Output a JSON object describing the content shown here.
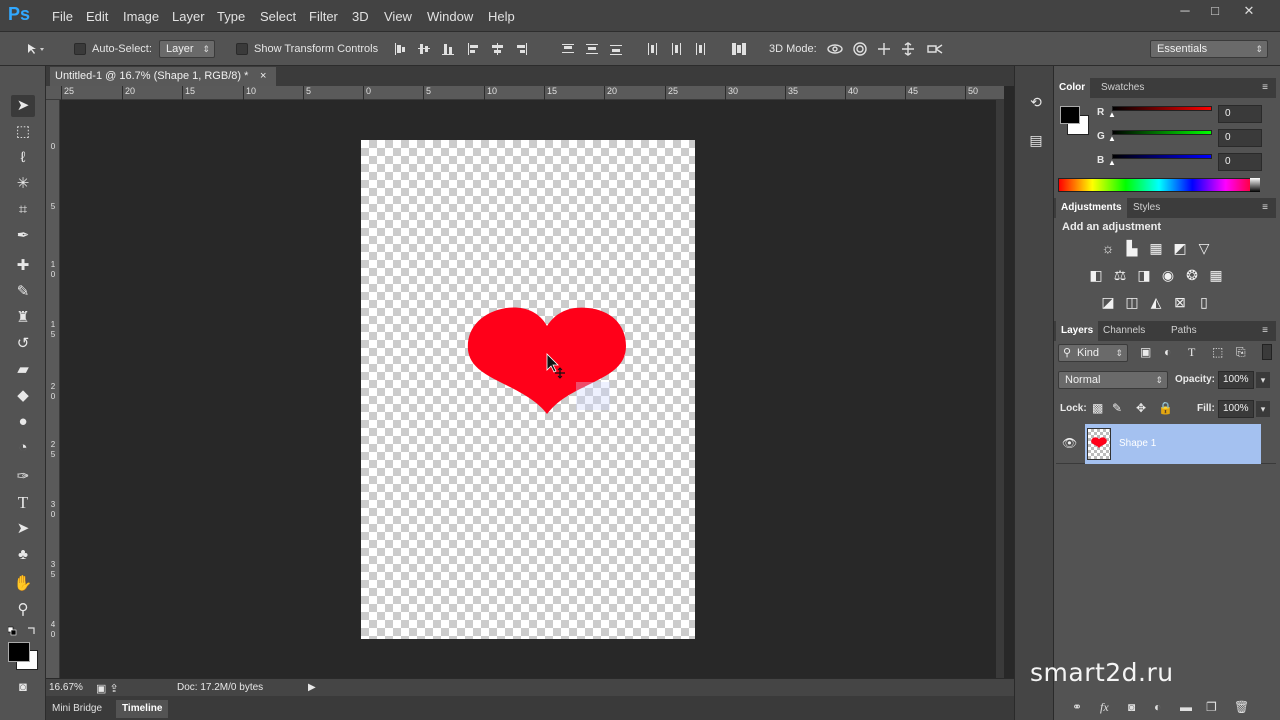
{
  "app": {
    "logo": "Ps"
  },
  "menu": [
    "File",
    "Edit",
    "Image",
    "Layer",
    "Type",
    "Select",
    "Filter",
    "3D",
    "View",
    "Window",
    "Help"
  ],
  "window_controls": [
    "─",
    "□",
    "✕"
  ],
  "options": {
    "auto_select_label": "Auto-Select:",
    "auto_select_value": "Layer",
    "transform_label": "Show Transform Controls",
    "mode_3d_label": "3D Mode:",
    "workspace": "Essentials"
  },
  "document": {
    "tab_title": "Untitled-1 @ 16.7% (Shape 1, RGB/8) *",
    "close": "×"
  },
  "ruler_top_labels": [
    "25",
    "20",
    "15",
    "10",
    "5",
    "0",
    "5",
    "10",
    "15",
    "20",
    "25",
    "30",
    "35",
    "40",
    "45",
    "50"
  ],
  "ruler_left_labels": [
    "0",
    "5",
    "1 0",
    "1 5",
    "2 0",
    "2 5",
    "3 0",
    "3 5",
    "4 0"
  ],
  "status": {
    "zoom": "16.67%",
    "doc": "Doc: 17.2M/0 bytes"
  },
  "bottom_tabs": [
    "Mini Bridge",
    "Timeline"
  ],
  "color_panel": {
    "tabs": [
      "Color",
      "Swatches"
    ],
    "r_label": "R",
    "g_label": "G",
    "b_label": "B",
    "r": "0",
    "g": "0",
    "b": "0"
  },
  "adjustments_panel": {
    "tabs": [
      "Adjustments",
      "Styles"
    ],
    "heading": "Add an adjustment"
  },
  "layers_panel": {
    "tabs": [
      "Layers",
      "Channels",
      "Paths"
    ],
    "kind": "Kind",
    "blend_mode": "Normal",
    "opacity_label": "Opacity:",
    "opacity": "100%",
    "lock_label": "Lock:",
    "fill_label": "Fill:",
    "fill": "100%",
    "layer_name": "Shape 1"
  },
  "watermark": "smart2d.ru",
  "colors": {
    "heart": "#ff0019",
    "accent": "#31a8ff",
    "layer_selected": "#a4c1f0"
  }
}
